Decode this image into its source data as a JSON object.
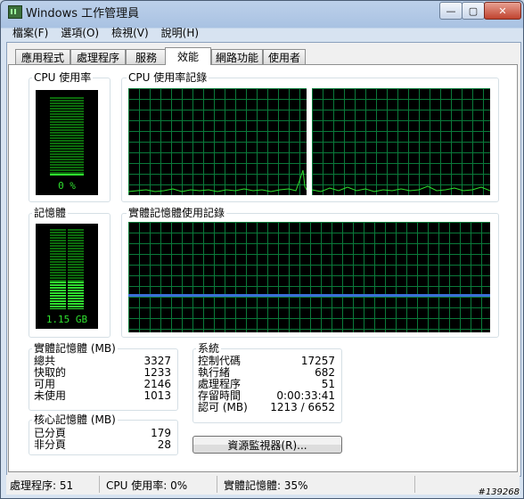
{
  "window": {
    "title": "Windows 工作管理員",
    "minimize": "—",
    "maximize": "▢",
    "close": "✕"
  },
  "menu": [
    "檔案(F)",
    "選項(O)",
    "檢視(V)",
    "說明(H)"
  ],
  "tabs": [
    "應用程式",
    "處理程序",
    "服務",
    "效能",
    "網路功能",
    "使用者"
  ],
  "active_tab": "效能",
  "cpu_usage": {
    "title": "CPU 使用率",
    "value": "0 %",
    "percent": 0
  },
  "cpu_history": {
    "title": "CPU 使用率記錄"
  },
  "memory": {
    "title": "記憶體",
    "value": "1.15 GB",
    "fill_fraction": 0.35
  },
  "memory_history": {
    "title": "實體記憶體使用記錄",
    "level_fraction": 0.35,
    "line_color": "#3a6fd8"
  },
  "physical_memory": {
    "title": "實體記憶體 (MB)",
    "rows": [
      {
        "label": "總共",
        "value": "3327"
      },
      {
        "label": "快取的",
        "value": "1233"
      },
      {
        "label": "可用",
        "value": "2146"
      },
      {
        "label": "未使用",
        "value": "1013"
      }
    ]
  },
  "kernel_memory": {
    "title": "核心記憶體 (MB)",
    "rows": [
      {
        "label": "已分頁",
        "value": "179"
      },
      {
        "label": "非分頁",
        "value": "28"
      }
    ]
  },
  "system": {
    "title": "系統",
    "rows": [
      {
        "label": "控制代碼",
        "value": "17257"
      },
      {
        "label": "執行緒",
        "value": "682"
      },
      {
        "label": "處理程序",
        "value": "51"
      },
      {
        "label": "存留時間",
        "value": "0:00:33:41"
      },
      {
        "label": "認可 (MB)",
        "value": "1213 / 6652"
      }
    ]
  },
  "resource_monitor_button": "資源監視器(R)...",
  "status": {
    "processes": "處理程序: 51",
    "cpu": "CPU 使用率: 0%",
    "memory": "實體記憶體: 35%"
  },
  "watermark": "#139268",
  "colors": {
    "meter_green": "#2fe02f",
    "grid_green": "#0a7a3a",
    "graph_bg": "#000000"
  }
}
